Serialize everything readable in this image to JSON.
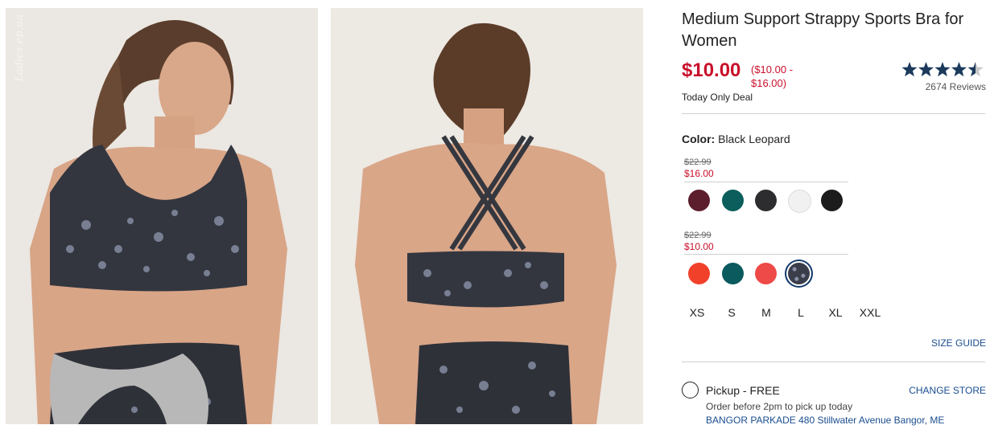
{
  "watermark": "Ladies.ep.ua",
  "product": {
    "title": "Medium Support Strappy Sports Bra for Women",
    "price": "$10.00",
    "price_range": "($10.00 - $16.00)",
    "deal": "Today Only Deal",
    "rating": 4.5,
    "reviews": "2674 Reviews"
  },
  "color": {
    "label": "Color:",
    "value": "Black Leopard",
    "groups": [
      {
        "was": "$22.99",
        "now": "$16.00",
        "swatches": [
          {
            "name": "burgundy",
            "color": "#5c1e2c"
          },
          {
            "name": "teal",
            "color": "#0b5e5b"
          },
          {
            "name": "charcoal",
            "color": "#2d2d2f"
          },
          {
            "name": "white",
            "color": "#f1f1f1"
          },
          {
            "name": "black",
            "color": "#1c1c1c"
          }
        ]
      },
      {
        "was": "$22.99",
        "now": "$10.00",
        "swatches": [
          {
            "name": "red-orange",
            "color": "#f2412b"
          },
          {
            "name": "dark-teal",
            "color": "#0b5a5e"
          },
          {
            "name": "coral",
            "color": "#ee4a47"
          },
          {
            "name": "black-leopard",
            "color": "#3a3d4a",
            "selected": true
          }
        ]
      }
    ]
  },
  "sizes": [
    "XS",
    "S",
    "M",
    "L",
    "XL",
    "XXL"
  ],
  "size_guide": "SIZE GUIDE",
  "pickup": {
    "label": "Pickup - FREE",
    "change": "CHANGE STORE",
    "order_note": "Order before 2pm to pick up today",
    "store": "BANGOR PARKADE 480 Stillwater Avenue  Bangor, ME"
  },
  "colors": {
    "sale": "#c9102b",
    "link": "#1a4d8f",
    "star": "#1b3a5c"
  }
}
